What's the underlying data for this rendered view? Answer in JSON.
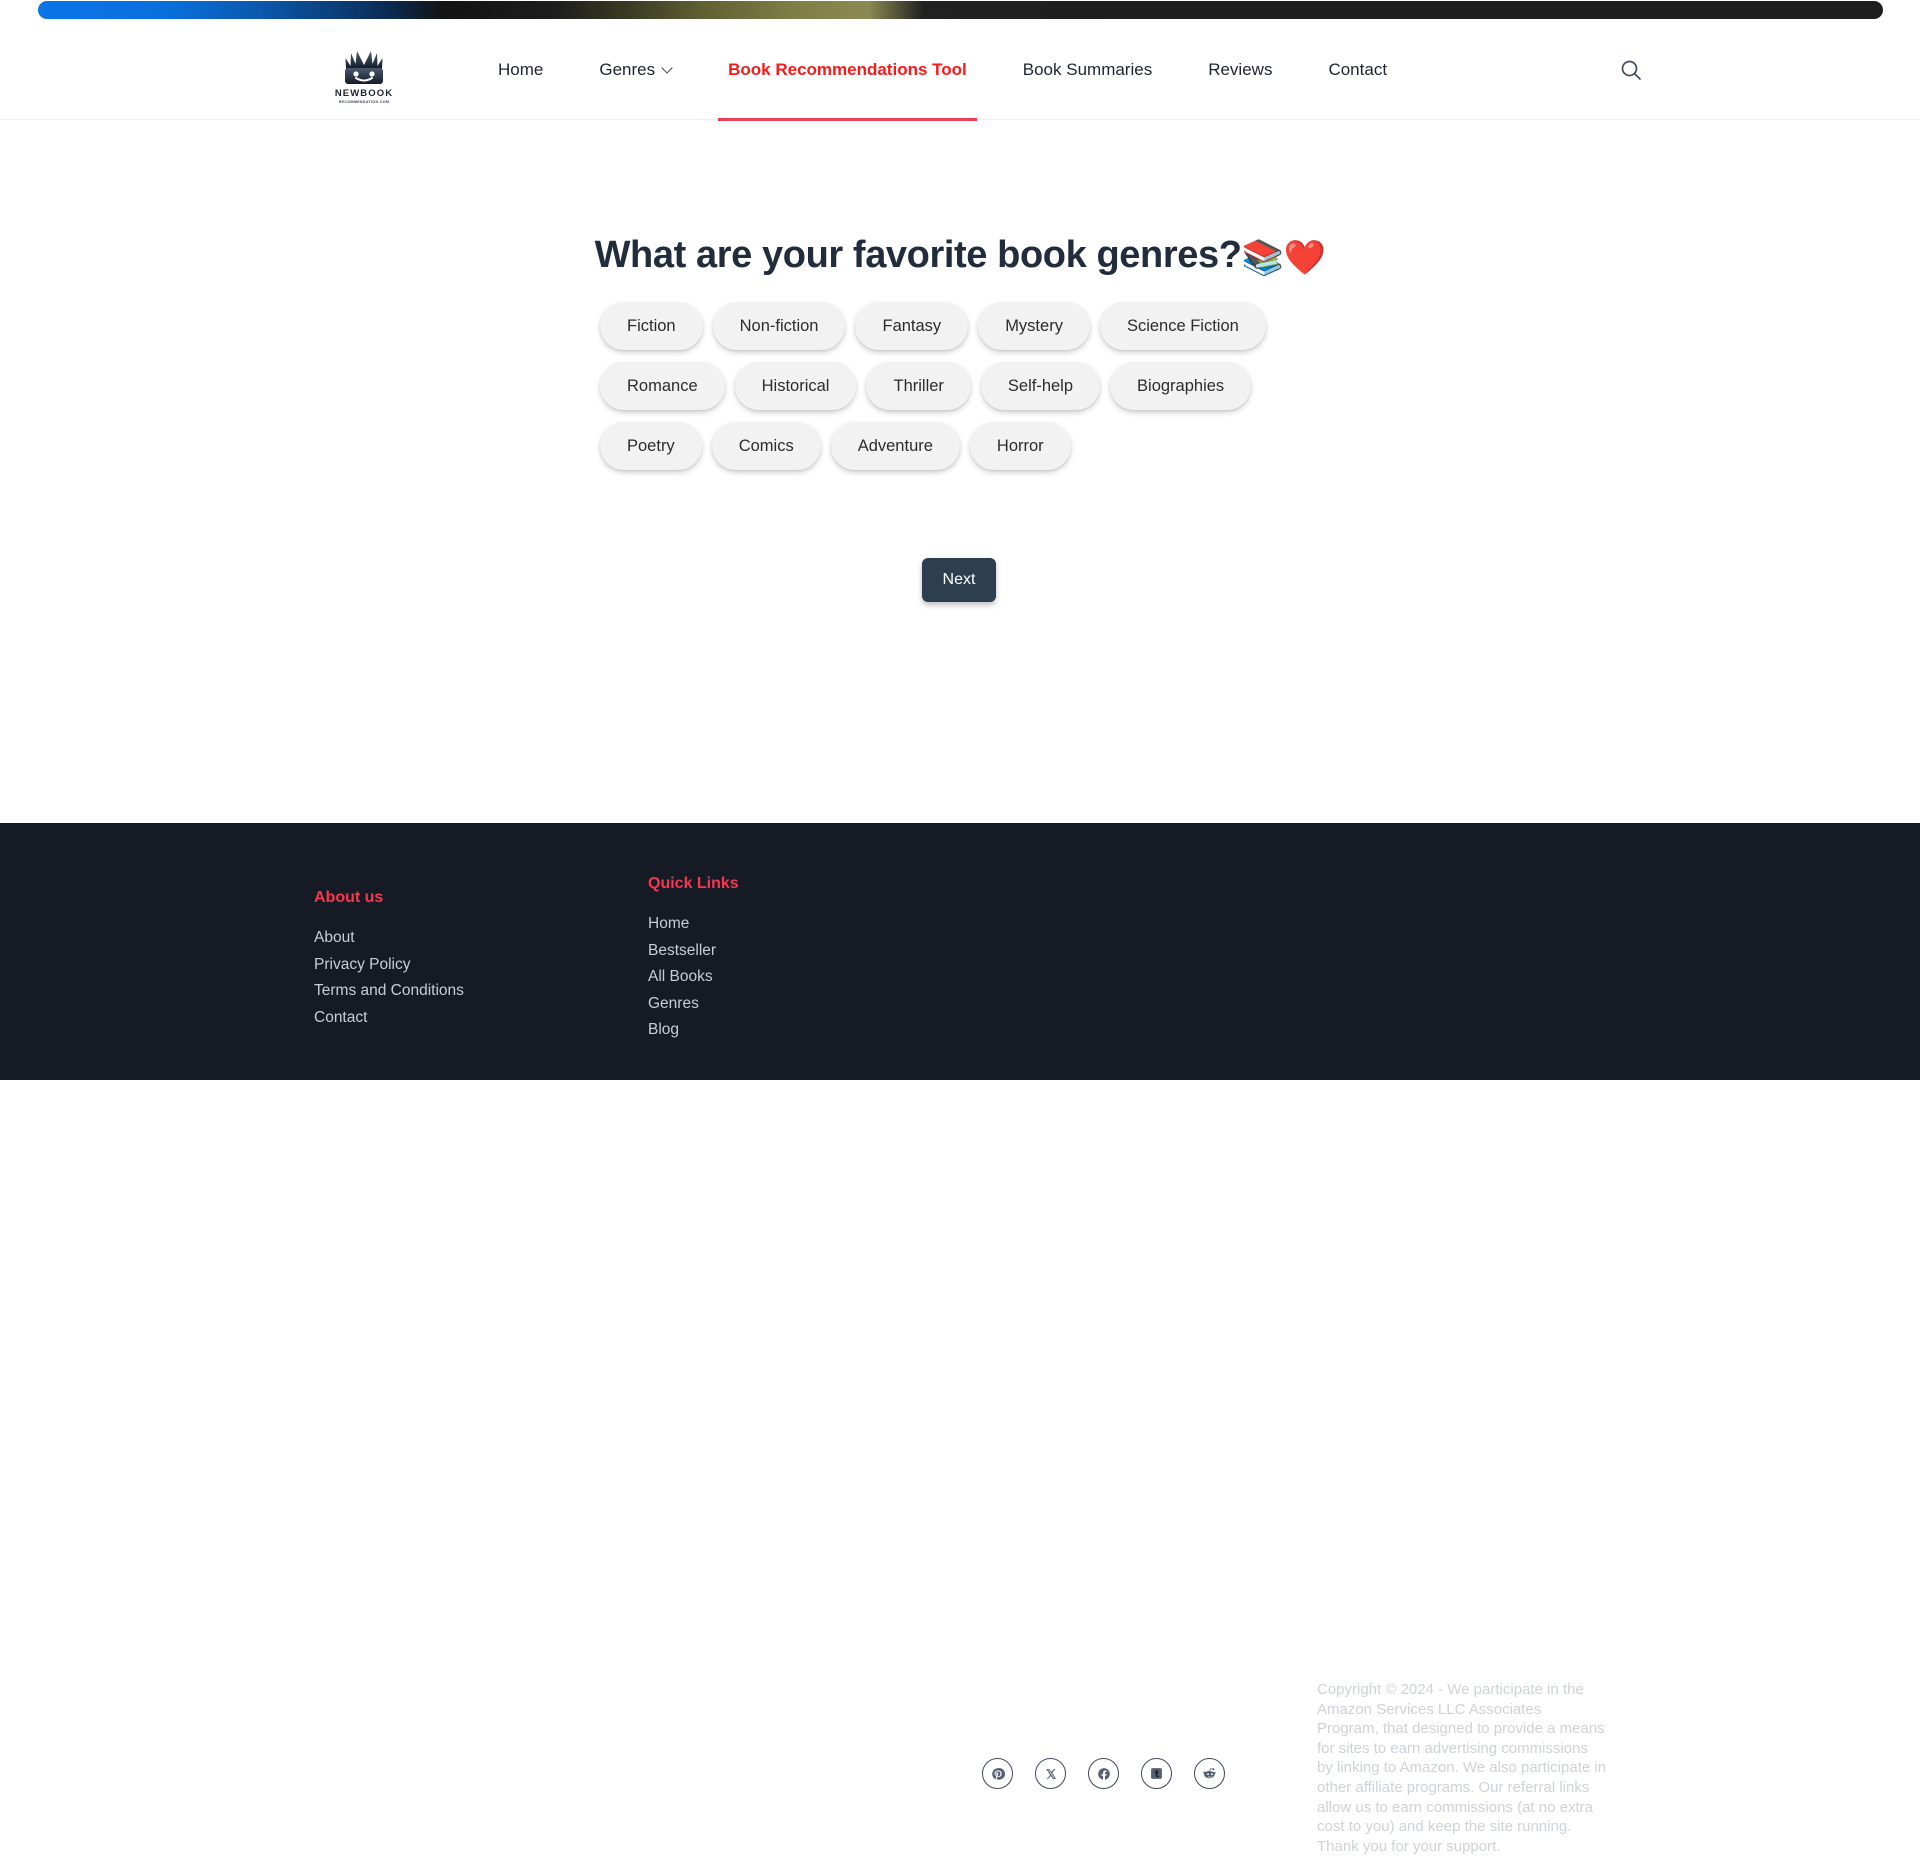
{
  "topbar": {
    "progress_label": "page-load-progress"
  },
  "header": {
    "logo": {
      "name": "NEWBOOK",
      "subtitle": "RECOMMENDATION.COM",
      "icon": "open-book-face-logo"
    },
    "nav": [
      {
        "label": "Home",
        "active": false,
        "has_dropdown": false
      },
      {
        "label": "Genres",
        "active": false,
        "has_dropdown": true
      },
      {
        "label": "Book Recommendations Tool",
        "active": true,
        "has_dropdown": false
      },
      {
        "label": "Book Summaries",
        "active": false,
        "has_dropdown": false
      },
      {
        "label": "Reviews",
        "active": false,
        "has_dropdown": false
      },
      {
        "label": "Contact",
        "active": false,
        "has_dropdown": false
      }
    ],
    "search_icon": "search-icon",
    "accent_color": "#fa1919",
    "underline_color": "#ed4056"
  },
  "main": {
    "question": "What are your favorite book genres?",
    "question_emoji_books": "📚",
    "question_emoji_heart": "❤️",
    "genres": [
      "Fiction",
      "Non-fiction",
      "Fantasy",
      "Mystery",
      "Science Fiction",
      "Romance",
      "Historical",
      "Thriller",
      "Self-help",
      "Biographies",
      "Poetry",
      "Comics",
      "Adventure",
      "Horror"
    ],
    "next_label": "Next",
    "next_color": "#2c3e50",
    "chip_color": "#f2f2f2"
  },
  "footer": {
    "background": "#161a24",
    "heading_color": "#f7374f",
    "about": {
      "title": "About us",
      "links": [
        "About",
        "Privacy Policy",
        "Terms and Conditions",
        "Contact"
      ]
    },
    "quick_links": {
      "title": "Quick Links",
      "links": [
        "Home",
        "Bestseller",
        "All Books",
        "Genres",
        "Blog"
      ]
    },
    "socials": [
      "pinterest-icon",
      "x-twitter-icon",
      "facebook-icon",
      "tumblr-icon",
      "reddit-icon"
    ],
    "copyright": "Copyright © 2024 - We participate in the Amazon Services LLC Associates Program, that designed to provide a means for sites to earn advertising commissions by linking to Amazon. We also participate in other affiliate programs. Our referral links allow us to earn commissions (at no extra cost to you) and keep the site running. Thank you for your support."
  }
}
